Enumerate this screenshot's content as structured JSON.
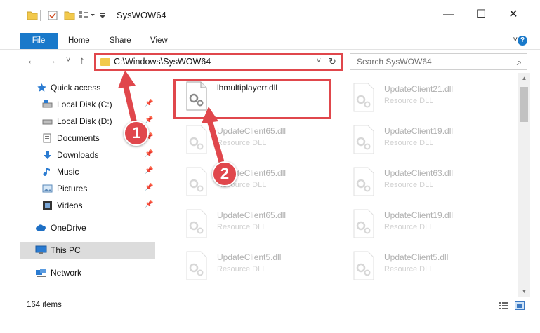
{
  "window": {
    "title": "SysWOW64",
    "minimize_glyph": "—",
    "maximize_glyph": "☐",
    "close_glyph": "✕"
  },
  "ribbon": {
    "file": "File",
    "home": "Home",
    "share": "Share",
    "view": "View",
    "expand_glyph": "˅",
    "help_glyph": "?"
  },
  "nav": {
    "back_glyph": "←",
    "forward_glyph": "→",
    "recent_glyph": "˅",
    "up_glyph": "↑",
    "address": "C:\\Windows\\SysWOW64",
    "address_dropdown_glyph": "˅",
    "refresh_glyph": "↻",
    "search_placeholder": "Search SysWOW64",
    "search_glyph": "⌕"
  },
  "sidebar": {
    "quick_access": "Quick access",
    "items": [
      {
        "label": "Local Disk (C:)",
        "icon": "drive-icon"
      },
      {
        "label": "Local Disk (D:)",
        "icon": "drive-icon"
      },
      {
        "label": "Documents",
        "icon": "documents-icon"
      },
      {
        "label": "Downloads",
        "icon": "downloads-icon"
      },
      {
        "label": "Music",
        "icon": "music-icon"
      },
      {
        "label": "Pictures",
        "icon": "pictures-icon"
      },
      {
        "label": "Videos",
        "icon": "videos-icon"
      }
    ],
    "pin_glyph": "📌",
    "onedrive": "OneDrive",
    "this_pc": "This PC",
    "network": "Network"
  },
  "files": {
    "highlighted": {
      "name": "lhmultiplayerr.dll",
      "type": ""
    },
    "col1": [
      {
        "name": "UpdateClient65.dll",
        "type": "Resource DLL"
      },
      {
        "name": "UpdateClient65.dll",
        "type": "Resource DLL"
      },
      {
        "name": "UpdateClient65.dll",
        "type": "Resource DLL"
      },
      {
        "name": "UpdateClient5.dll",
        "type": "Resource DLL"
      }
    ],
    "col2": [
      {
        "name": "UpdateClient21.dll",
        "type": "Resource DLL"
      },
      {
        "name": "UpdateClient19.dll",
        "type": "Resource DLL"
      },
      {
        "name": "UpdateClient63.dll",
        "type": "Resource DLL"
      },
      {
        "name": "UpdateClient19.dll",
        "type": "Resource DLL"
      },
      {
        "name": "UpdateClient5.dll",
        "type": "Resource DLL"
      }
    ]
  },
  "status": {
    "item_count": "164 items"
  },
  "callouts": {
    "step1": "1",
    "step2": "2"
  },
  "colors": {
    "accent": "#1979ca",
    "highlight": "#e0474c",
    "folder": "#f2c94c"
  }
}
